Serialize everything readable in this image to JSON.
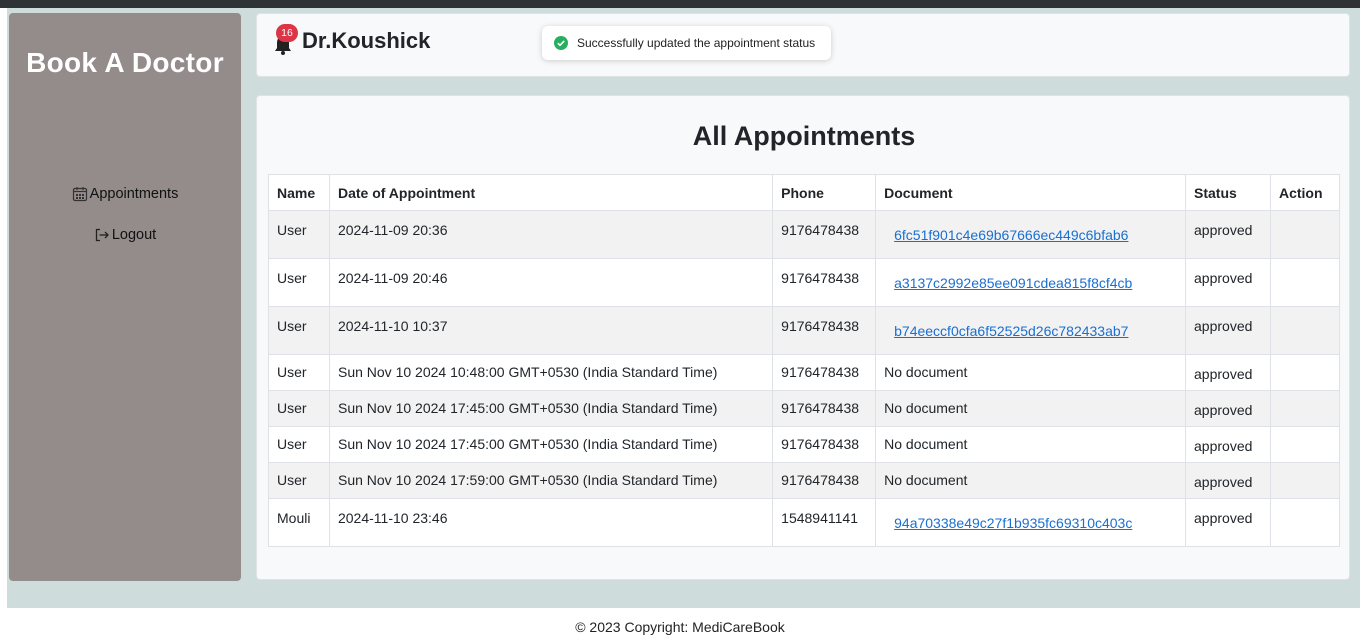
{
  "brand": "Book A Doctor",
  "sidebar": {
    "items": [
      {
        "label": "Appointments",
        "icon": "calendar-icon"
      },
      {
        "label": "Logout",
        "icon": "logout-icon"
      }
    ]
  },
  "header": {
    "doctor_name": "Dr.Koushick",
    "notification_count": "16",
    "toast": "Successfully updated the appointment status"
  },
  "main": {
    "title": "All Appointments",
    "columns": [
      "Name",
      "Date of Appointment",
      "Phone",
      "Document",
      "Status",
      "Action"
    ],
    "rows": [
      {
        "name": "User",
        "date": "2024-11-09 20:36",
        "phone": "9176478438",
        "document": "6fc51f901c4e69b67666ec449c6bfab6",
        "has_link": true,
        "status": "approved"
      },
      {
        "name": "User",
        "date": "2024-11-09 20:46",
        "phone": "9176478438",
        "document": "a3137c2992e85ee091cdea815f8cf4cb",
        "has_link": true,
        "status": "approved"
      },
      {
        "name": "User",
        "date": "2024-11-10 10:37",
        "phone": "9176478438",
        "document": "b74eeccf0cfa6f52525d26c782433ab7",
        "has_link": true,
        "status": "approved"
      },
      {
        "name": "User",
        "date": "Sun Nov 10 2024 10:48:00 GMT+0530 (India Standard Time)",
        "phone": "9176478438",
        "document": "No document",
        "has_link": false,
        "status": "approved"
      },
      {
        "name": "User",
        "date": "Sun Nov 10 2024 17:45:00 GMT+0530 (India Standard Time)",
        "phone": "9176478438",
        "document": "No document",
        "has_link": false,
        "status": "approved"
      },
      {
        "name": "User",
        "date": "Sun Nov 10 2024 17:45:00 GMT+0530 (India Standard Time)",
        "phone": "9176478438",
        "document": "No document",
        "has_link": false,
        "status": "approved"
      },
      {
        "name": "User",
        "date": "Sun Nov 10 2024 17:59:00 GMT+0530 (India Standard Time)",
        "phone": "9176478438",
        "document": "No document",
        "has_link": false,
        "status": "approved"
      },
      {
        "name": "Mouli",
        "date": "2024-11-10 23:46",
        "phone": "1548941141",
        "document": "94a70338e49c27f1b935fc69310c403c",
        "has_link": true,
        "status": "approved"
      }
    ]
  },
  "footer": "© 2023 Copyright: MediCareBook",
  "colors": {
    "sidebar_bg": "#948b8b",
    "app_bg": "#cfdcdc",
    "badge": "#dc3545",
    "link": "#1a6fd1",
    "toast_success": "#27ae60"
  }
}
